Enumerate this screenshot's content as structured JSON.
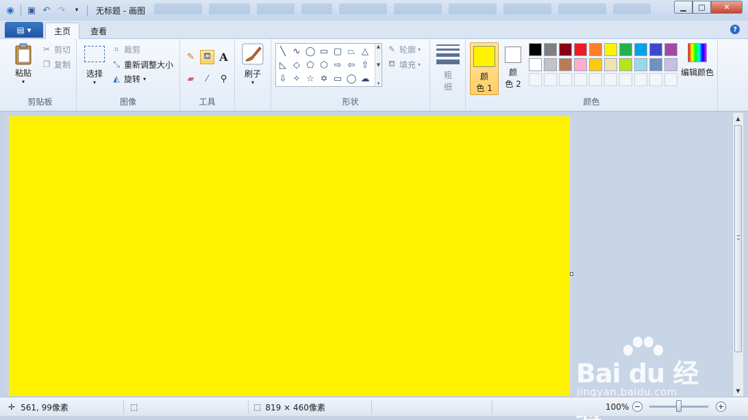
{
  "title_bar": {
    "title": "无标题 - 画图",
    "minimize": "▁",
    "maximize": "□",
    "close": "✕"
  },
  "tabs": {
    "app_menu": "▤ ▾",
    "home": "主页",
    "view": "查看",
    "help": "?"
  },
  "ribbon": {
    "clipboard": {
      "label": "剪贴板",
      "paste": "粘贴",
      "cut": "剪切",
      "copy": "复制"
    },
    "image": {
      "label": "图像",
      "select": "选择",
      "crop": "裁剪",
      "resize": "重新调整大小",
      "rotate": "旋转"
    },
    "tools": {
      "label": "工具"
    },
    "brush": {
      "label": "刷子"
    },
    "shapes": {
      "label": "形状",
      "outline": "轮廓",
      "fill": "填充"
    },
    "size": {
      "label_line1": "粗",
      "label_line2": "细"
    },
    "colors": {
      "label": "颜色",
      "color1_line1": "颜",
      "color1_line2": "色 1",
      "color2_line1": "颜",
      "color2_line2": "色 2",
      "edit_colors": "编辑颜色",
      "color1_value": "#fff200",
      "color2_value": "#ffffff",
      "palette_row1": [
        "#000000",
        "#7f7f7f",
        "#880015",
        "#ed1c24",
        "#ff7f27",
        "#fff200",
        "#22b14c",
        "#00a2e8",
        "#3f48cc",
        "#a349a4"
      ],
      "palette_row2": [
        "#ffffff",
        "#c3c3c3",
        "#b97a57",
        "#ffaec9",
        "#ffc90e",
        "#efe4b0",
        "#b5e61d",
        "#99d9ea",
        "#7092be",
        "#c8bfe7"
      ]
    }
  },
  "canvas": {
    "fill_color": "#fff200"
  },
  "status_bar": {
    "cursor_position": "561, 99像素",
    "image_size": "819 × 460像素",
    "zoom": "100%",
    "zoom_level": 1.0
  },
  "watermark": {
    "logo": "Bai du 经验",
    "url": "jingyan.baidu.com"
  }
}
